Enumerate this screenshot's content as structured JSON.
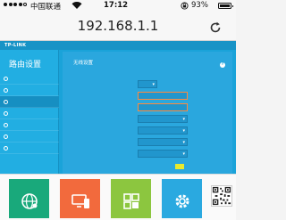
{
  "status_bar": {
    "carrier": "中国联通",
    "time": "17:12",
    "battery": "93%",
    "battery_level": 0.93
  },
  "browser": {
    "url": "192.168.1.1"
  },
  "router": {
    "brand": "TP-LINK",
    "sidebar_title": "路由设置",
    "menu_items": [
      {
        "label": "",
        "active": false
      },
      {
        "label": "",
        "active": false
      },
      {
        "label": "",
        "active": true
      },
      {
        "label": "",
        "active": false
      },
      {
        "label": "",
        "active": false
      },
      {
        "label": "",
        "active": false
      },
      {
        "label": "",
        "active": false
      }
    ],
    "panel_title": "无线设置",
    "help": "?",
    "fields": [
      {
        "value": ""
      },
      {
        "value": ""
      },
      {
        "value": ""
      },
      {
        "value": ""
      },
      {
        "value": ""
      },
      {
        "value": ""
      },
      {
        "value": ""
      }
    ]
  },
  "tiles": [
    {
      "label": "",
      "color": "#19a97b",
      "icon": "globe-icon"
    },
    {
      "label": "",
      "color": "#f26a3d",
      "icon": "devices-icon"
    },
    {
      "label": "",
      "color": "#8cc63f",
      "icon": "apps-icon"
    },
    {
      "label": "",
      "color": "#2aa9e0",
      "icon": "gear-icon"
    }
  ],
  "colors": {
    "router_bg": "#1aa3d9",
    "sidebar_bg": "#22aee2",
    "highlight_border": "#ff8a3d",
    "save_button": "#e8ea2e"
  }
}
